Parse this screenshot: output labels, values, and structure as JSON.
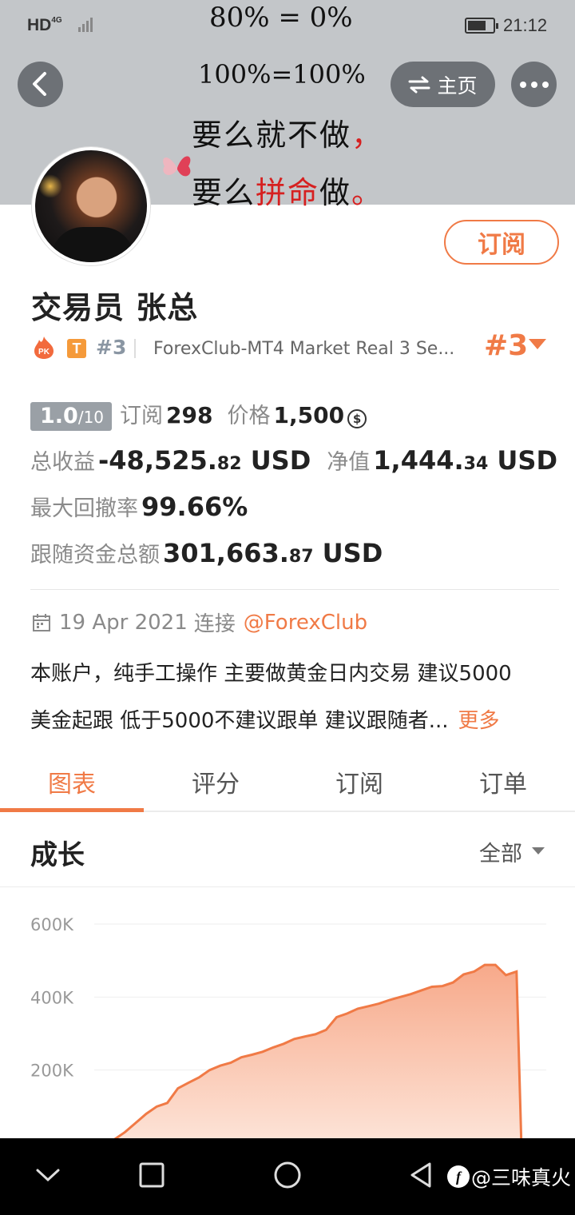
{
  "status_bar": {
    "network": "HD",
    "signal_type": "4G",
    "time": "21:12"
  },
  "banner": {
    "line1": "80% = 0%",
    "line2": "100%=100%",
    "line3_main": "要么就不做",
    "line3_punct": "，",
    "line4_a": "要么",
    "line4_b": "拼命",
    "line4_c": "做",
    "line4_punct": "。"
  },
  "nav": {
    "home_label": "主页",
    "back_icon": "chevron-left-icon",
    "more_icon": "more-dots-icon"
  },
  "profile": {
    "name": "交易员  张总",
    "subscribe_label": "订阅",
    "pk_badge": "PK",
    "tier_badge": "T",
    "rank_small": "#3",
    "server": "ForexClub-MT4 Market Real 3 Se...",
    "rank_big": "#3"
  },
  "stats": {
    "score_main": "1.0",
    "score_total": "/10",
    "subscribers_label": "订阅",
    "subscribers_value": "298",
    "price_label": "价格",
    "price_value": "1,500",
    "coin_symbol": "$",
    "total_profit_label": "总收益",
    "total_profit_main": "-48,525.",
    "total_profit_dec": "82",
    "total_profit_unit": "USD",
    "equity_label": "净值",
    "equity_main": "1,444.",
    "equity_dec": "34",
    "equity_unit": "USD",
    "drawdown_label": "最大回撤率",
    "drawdown_value": "99.66%",
    "follow_label": "跟随资金总额",
    "follow_main": "301,663.",
    "follow_dec": "87",
    "follow_unit": "USD"
  },
  "info": {
    "date": "19 Apr 2021",
    "connect_label": "连接",
    "broker_link": "@ForexClub",
    "description_line1": "本账户，纯手工操作 主要做黄金日内交易 建议5000",
    "description_line2": "美金起跟 低于5000不建议跟单 建议跟随者...",
    "more_label": "更多"
  },
  "tabs": [
    {
      "label": "图表",
      "active": true
    },
    {
      "label": "评分",
      "active": false
    },
    {
      "label": "订阅",
      "active": false
    },
    {
      "label": "订单",
      "active": false
    }
  ],
  "growth": {
    "title": "成长",
    "range_label": "全部"
  },
  "chart_data": {
    "type": "area",
    "title": "",
    "xlabel": "",
    "ylabel": "",
    "y_ticks": [
      "600K",
      "400K",
      "200K"
    ],
    "ylim": [
      0,
      600000
    ],
    "grid": true,
    "color": "#f07a46",
    "fill_color": "#f9c0a6",
    "series": [
      {
        "values": [
          0,
          10000,
          30000,
          55000,
          80000,
          100000,
          110000,
          150000,
          165000,
          180000,
          200000,
          212000,
          220000,
          235000,
          242000,
          250000,
          262000,
          272000,
          285000,
          292000,
          298000,
          310000,
          345000,
          355000,
          368000,
          375000,
          382000,
          392000,
          400000,
          408000,
          418000,
          428000,
          430000,
          440000,
          462000,
          470000,
          488000,
          488000,
          460000,
          470000,
          0
        ]
      }
    ]
  },
  "system_nav": {
    "watermark": "@三味真火",
    "watermark_logo": "f"
  }
}
